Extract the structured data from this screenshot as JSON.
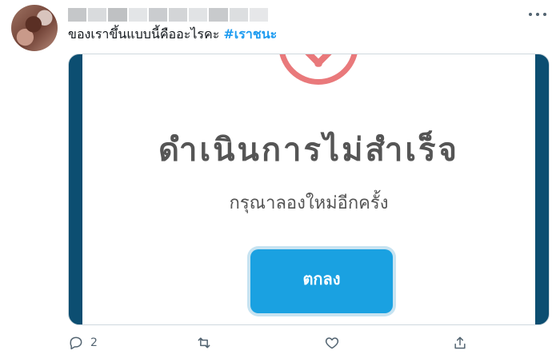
{
  "tweet": {
    "text": "ของเราขึ้นแบบนี้คืออะไรคะ",
    "hashtag": "#เราชนะ"
  },
  "media": {
    "dialog_title": "ดำเนินการไม่สำเร็จ",
    "dialog_message": "กรุณาลองใหม่อีกครั้ง",
    "ok_button": "ตกลง"
  },
  "actions": {
    "reply_count": "2"
  },
  "colors": {
    "accent": "#1d9bf0",
    "error": "#e9797b",
    "button": "#1aa1e1",
    "frame": "#0c4e71"
  },
  "icons": [
    "more-icon",
    "reply-icon",
    "retweet-icon",
    "like-icon",
    "share-icon"
  ]
}
